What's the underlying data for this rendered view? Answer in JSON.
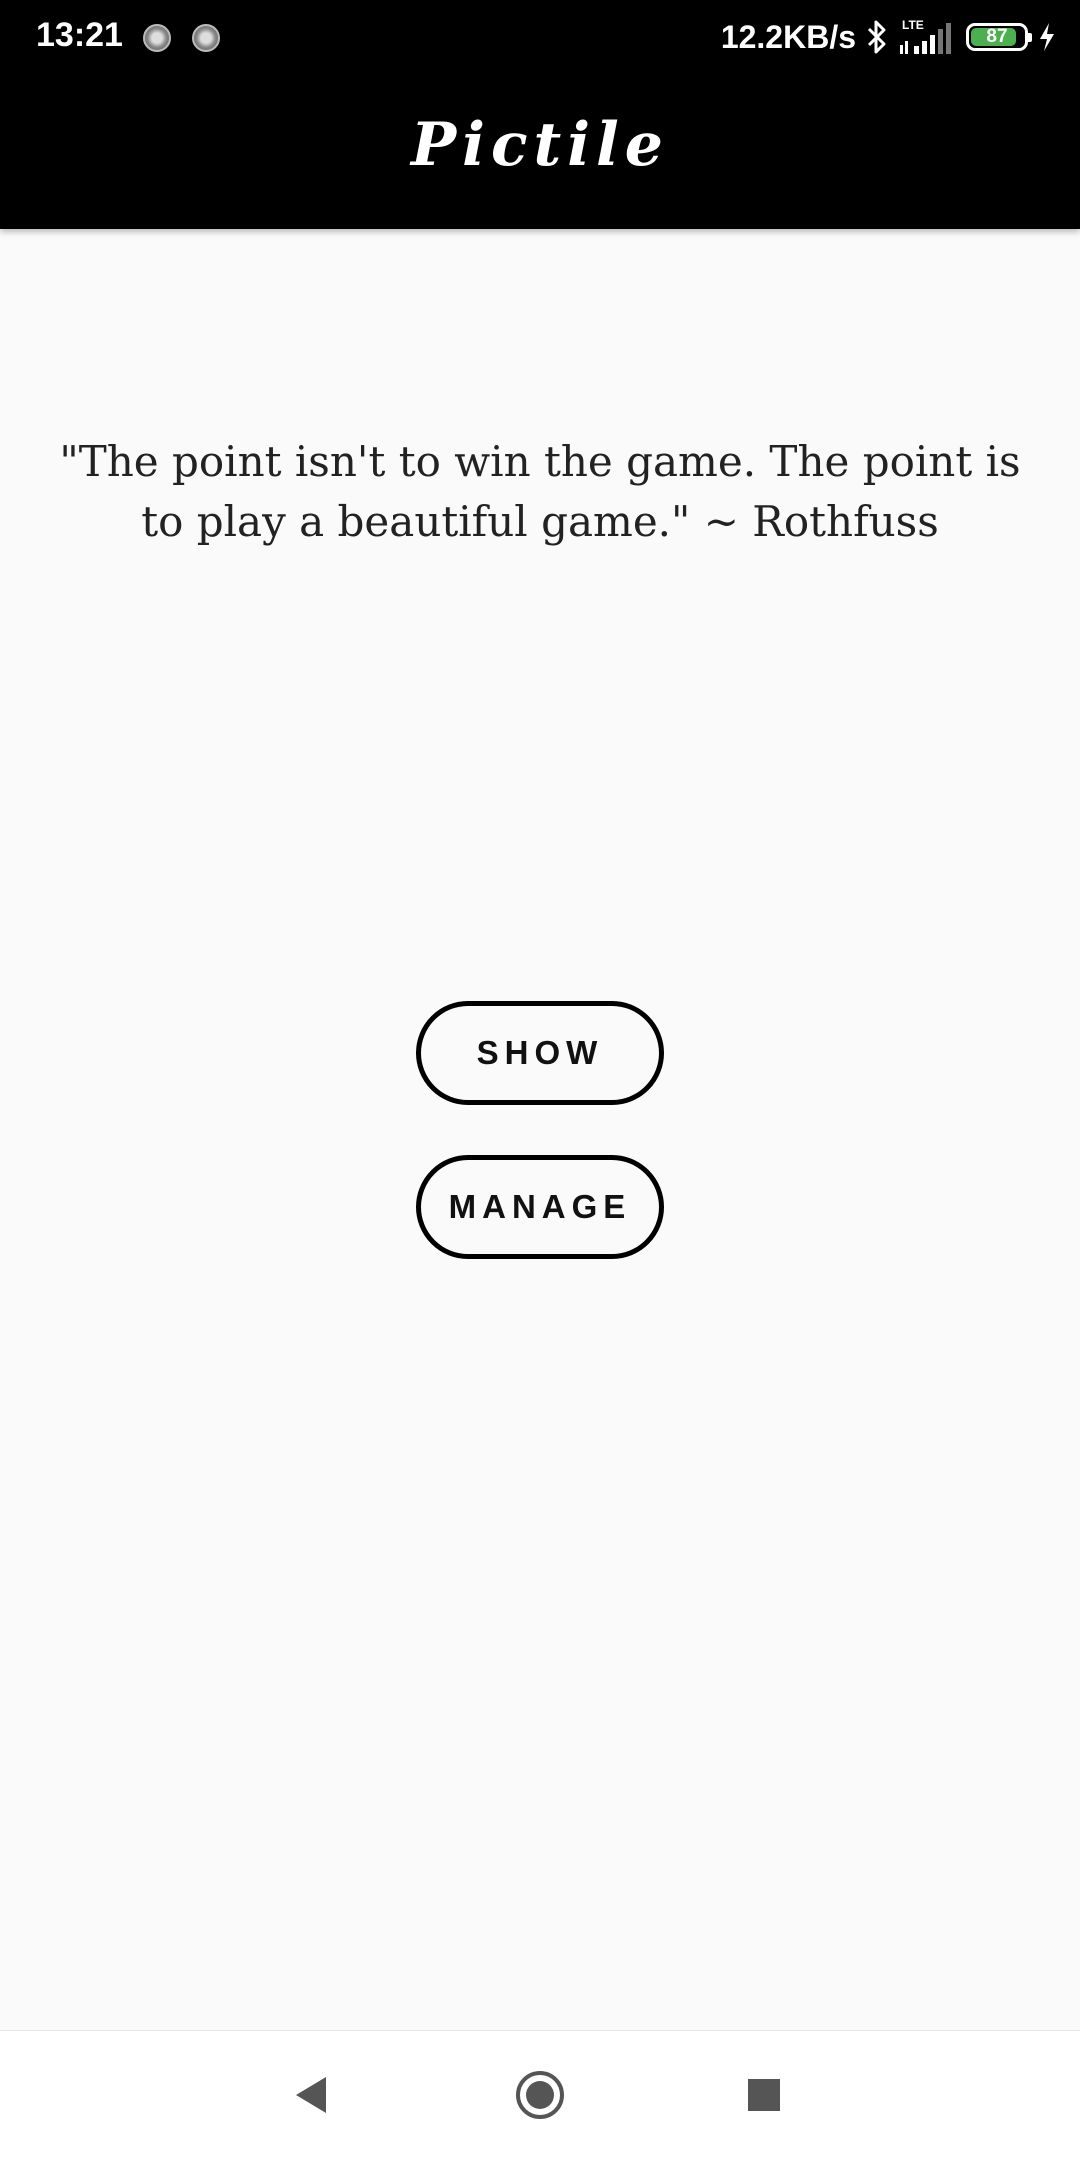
{
  "status_bar": {
    "time": "13:21",
    "net_speed": "12.2KB/s",
    "network_type": "LTE",
    "battery_level": "87",
    "battery_percent": 87,
    "icons": [
      "notification-dot-icon",
      "notification-dot-icon",
      "bluetooth-icon",
      "signal-icon",
      "battery-icon",
      "charging-icon"
    ]
  },
  "app_bar": {
    "title": "Pictile"
  },
  "main": {
    "quote": "\"The point isn't to win the game. The point is to play a beautiful game.\" ~ Rothfuss",
    "show_label": "SHOW",
    "manage_label": "MANAGE"
  },
  "nav_bar": {
    "icons": [
      "back-icon",
      "home-icon",
      "recent-apps-icon"
    ]
  },
  "colors": {
    "header_bg": "#000000",
    "page_bg": "#fafafa",
    "battery_fill": "#4caf50",
    "text": "#222222"
  }
}
